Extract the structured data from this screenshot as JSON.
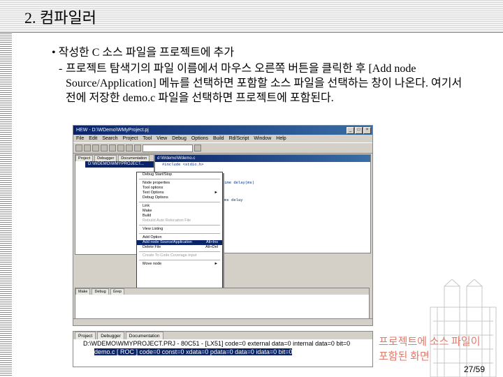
{
  "slide": {
    "title": "2. 컴파일러",
    "bullet": "• 작성한 C 소스 파일을 프로젝트에 추가",
    "dash": "-",
    "body": "프로젝트 탐색기의 파일 이름에서 마우스 오른쪽 버튼을 클릭한 후 [Add node Source/Application] 메뉴를 선택하면 포함할 소스 파일을 선택하는 창이 나온다. 여기서 전에 저장한 demo.c 파일을 선택하면 프로젝트에 포함된다.",
    "caption_line1": "프로젝트에 소스 파일이",
    "caption_line2": "포함된 화면",
    "page_number": "27/59"
  },
  "window": {
    "title": "HEW - D:\\WDemo\\WMyProject.pj",
    "menu": [
      "File",
      "Edit",
      "Search",
      "Project",
      "Tool",
      "View",
      "Debug",
      "Options",
      "Build",
      "Rd/Script",
      "Window",
      "Help"
    ],
    "editor_title": "d:\\Wdemo\\Wdemo.c",
    "code_lines": [
      "#include <stdio.h>",
      "",
      "",
      "                       // time delay(ms)",
      "",
      "",
      "                       // 1ms delay"
    ],
    "project_tabs": [
      "Project",
      "Debugger",
      "Documentation"
    ],
    "project_root": "D:\\WDEMO\\WMYPROJECT...",
    "context_menu": [
      {
        "label": "Debug Start/Stop",
        "shortcut": "",
        "disabled": false,
        "sep_after": true
      },
      {
        "label": "Node properties",
        "shortcut": "",
        "disabled": false
      },
      {
        "label": "Tool options",
        "shortcut": "",
        "disabled": false
      },
      {
        "label": "Text Options",
        "shortcut": "►",
        "disabled": false
      },
      {
        "label": "Debug Options",
        "shortcut": "",
        "disabled": false,
        "sep_after": true
      },
      {
        "label": "Link",
        "shortcut": "",
        "disabled": false
      },
      {
        "label": "Make",
        "shortcut": "",
        "disabled": false
      },
      {
        "label": "Build",
        "shortcut": "",
        "disabled": false
      },
      {
        "label": "Rebuild Auto Relocation File",
        "shortcut": "",
        "disabled": true,
        "sep_after": true
      },
      {
        "label": "View Listing",
        "shortcut": "",
        "disabled": false,
        "sep_after": true
      },
      {
        "label": "Add Option",
        "shortcut": "",
        "disabled": false
      },
      {
        "label": "Add node Source/Application",
        "shortcut": "Alt+Ins",
        "disabled": false,
        "highlighted": true
      },
      {
        "label": "Delete File",
        "shortcut": "Alt+Del",
        "disabled": false,
        "sep_after": true
      },
      {
        "label": "Create To Code Coverage input",
        "shortcut": "",
        "disabled": true,
        "sep_after": true
      },
      {
        "label": "Move node",
        "shortcut": "►",
        "disabled": false
      }
    ],
    "output_tabs": [
      "Make",
      "Debug",
      "Grep"
    ]
  },
  "bottom_shot": {
    "tabs": [
      "Project",
      "Debugger",
      "Documentation"
    ],
    "row1": "D:\\WDEMO\\WMYPROJECT.PRJ - 80C51 - [LX51] code=0 external data=0 internal data=0 bit=0",
    "row2": "demo.c [ ROC ] code=0 const=0 xdata=0 pdata=0 data=0 idata=0 bit=0"
  }
}
